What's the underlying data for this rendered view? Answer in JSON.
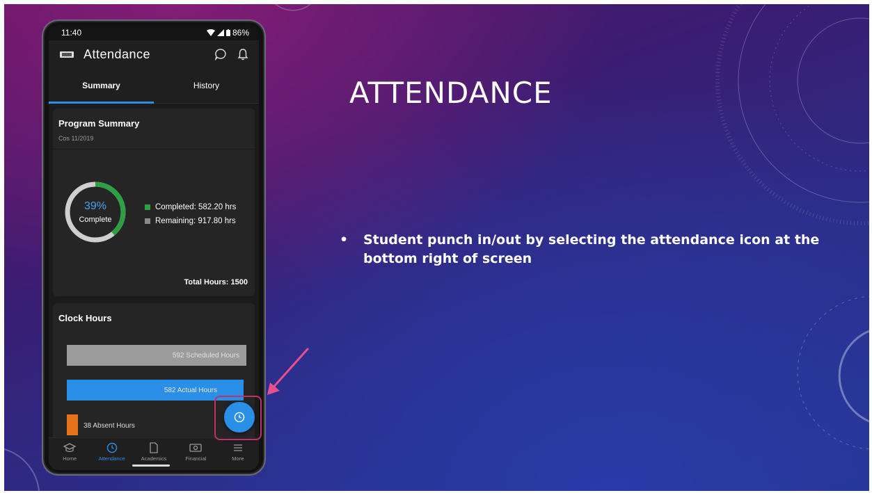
{
  "slide": {
    "title": "ATTENDANCE",
    "bullet": "Student punch in/out by selecting the attendance icon at the bottom right of screen",
    "bullet_symbol": "•"
  },
  "colors": {
    "accent": "#2a8fe6",
    "completed": "#2ea043",
    "remaining": "#8a8a8a",
    "absent": "#e6721c",
    "highlight": "#c2306c"
  },
  "statusbar": {
    "time": "11:40",
    "battery": "86%"
  },
  "appbar": {
    "title": "Attendance",
    "icons": [
      "app-logo-icon",
      "chat-icon",
      "bell-icon"
    ]
  },
  "tabs": [
    {
      "label": "Summary",
      "active": true
    },
    {
      "label": "History",
      "active": false
    }
  ],
  "program_summary": {
    "title": "Program Summary",
    "subtitle": "Cos 11/2019",
    "percent": "39%",
    "percent_value": 0.39,
    "percent_label": "Complete",
    "completed": "Completed: 582.20 hrs",
    "remaining": "Remaining: 917.80 hrs",
    "total": "Total Hours: 1500"
  },
  "clock_hours": {
    "title": "Clock Hours",
    "scheduled": {
      "label": "592 Scheduled Hours",
      "value": 592
    },
    "actual": {
      "label": "582 Actual Hours",
      "value": 582
    },
    "absent": {
      "label": "38 Absent Hours",
      "value": 38
    }
  },
  "fab": {
    "icon": "clock-icon"
  },
  "bottom_nav": [
    {
      "label": "Home",
      "icon": "graduation-cap-icon",
      "active": false
    },
    {
      "label": "Attendance",
      "icon": "clock-icon",
      "active": true
    },
    {
      "label": "Academics",
      "icon": "document-icon",
      "active": false
    },
    {
      "label": "Financial",
      "icon": "money-icon",
      "active": false
    },
    {
      "label": "More",
      "icon": "menu-icon",
      "active": false
    }
  ]
}
